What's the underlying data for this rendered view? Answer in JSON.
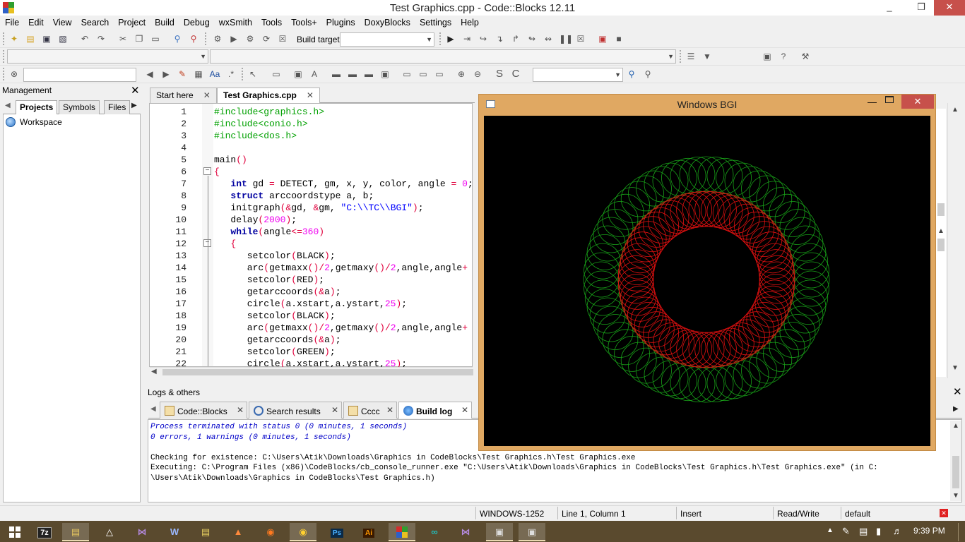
{
  "window": {
    "title": "Test Graphics.cpp - Code::Blocks 12.11",
    "minimize": "_",
    "maximize": "❒",
    "close": "✕"
  },
  "menu": [
    "File",
    "Edit",
    "View",
    "Search",
    "Project",
    "Build",
    "Debug",
    "wxSmith",
    "Tools",
    "Tools+",
    "Plugins",
    "DoxyBlocks",
    "Settings",
    "Help"
  ],
  "toolbar": {
    "build_target_label": "Build target:",
    "build_target_value": "",
    "doxy_comment": "/**",
    "doxy_inline": "*<"
  },
  "management": {
    "title": "Management",
    "tabs": [
      "Projects",
      "Symbols",
      "Files"
    ],
    "active_tab": "Projects",
    "workspace": "Workspace"
  },
  "editor": {
    "tabs": [
      {
        "label": "Start here",
        "active": false
      },
      {
        "label": "Test Graphics.cpp",
        "active": true
      }
    ],
    "line_numbers": [
      "1",
      "2",
      "3",
      "4",
      "5",
      "6",
      "7",
      "8",
      "9",
      "10",
      "11",
      "12",
      "13",
      "14",
      "15",
      "16",
      "17",
      "18",
      "19",
      "20",
      "21",
      "22"
    ],
    "lines": [
      "#include<graphics.h>",
      "#include<conio.h>",
      "#include<dos.h>",
      "",
      "main()",
      "{",
      "   int gd = DETECT, gm, x, y, color, angle = 0;",
      "   struct arccoordstype a, b;",
      "   initgraph(&gd, &gm, \"C:\\\\TC\\\\BGI\");",
      "   delay(2000);",
      "   while(angle<=360)",
      "   {",
      "      setcolor(BLACK);",
      "      arc(getmaxx()/2,getmaxy()/2,angle,angle+",
      "      setcolor(RED);",
      "      getarccoords(&a);",
      "      circle(a.xstart,a.ystart,25);",
      "      setcolor(BLACK);",
      "      arc(getmaxx()/2,getmaxy()/2,angle,angle+",
      "      getarccoords(&a);",
      "      setcolor(GREEN);",
      "      circle(a.xstart,a.ystart,25);"
    ]
  },
  "bgi": {
    "title": "Windows BGI",
    "close": "✕",
    "colors": {
      "background": "#000000",
      "outer": "#18a018",
      "inner": "#e01010"
    }
  },
  "logs": {
    "title": "Logs & others",
    "tabs": [
      {
        "label": "Code::Blocks",
        "active": false
      },
      {
        "label": "Search results",
        "active": false
      },
      {
        "label": "Cccc",
        "active": false
      },
      {
        "label": "Build log",
        "active": true
      }
    ],
    "lines": [
      {
        "text": "Process terminated with status 0 (0 minutes, 1 seconds)",
        "style": "blue"
      },
      {
        "text": "0 errors, 1 warnings (0 minutes, 1 seconds)",
        "style": "blue"
      },
      {
        "text": "",
        "style": "plain"
      },
      {
        "text": "Checking for existence: C:\\Users\\Atik\\Downloads\\Graphics in CodeBlocks\\Test Graphics.h\\Test Graphics.exe",
        "style": "plain"
      },
      {
        "text": "Executing: C:\\Program Files (x86)\\CodeBlocks/cb_console_runner.exe \"C:\\Users\\Atik\\Downloads\\Graphics in CodeBlocks\\Test Graphics.h\\Test Graphics.exe\" (in C:",
        "style": "plain"
      },
      {
        "text": "\\Users\\Atik\\Downloads\\Graphics in CodeBlocks\\Test Graphics.h)",
        "style": "plain"
      }
    ]
  },
  "status": {
    "encoding": "WINDOWS-1252",
    "position": "Line 1, Column 1",
    "mode": "Insert",
    "access": "Read/Write",
    "profile": "default"
  },
  "taskbar": {
    "items": [
      "7z",
      "Ps",
      "Ai"
    ],
    "time": "9:39 PM"
  }
}
